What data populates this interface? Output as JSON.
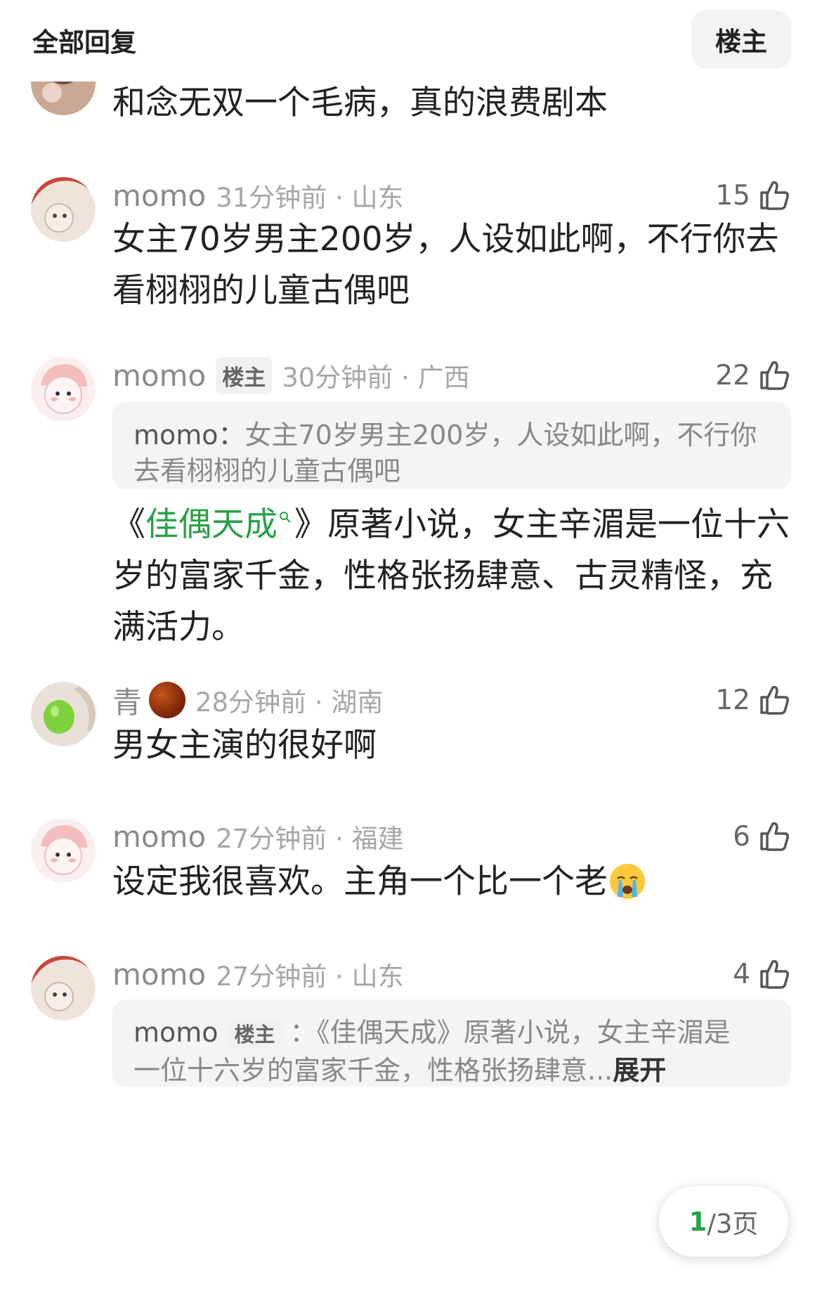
{
  "header": {
    "title": "全部回复",
    "filter_label": "楼主"
  },
  "comments": [
    {
      "text": "和念无双一个毛病，真的浪费剧本"
    },
    {
      "user": "momo",
      "time_loc": "31分钟前 · 山东",
      "likes": "15",
      "text": "女主70岁男主200岁，人设如此啊，不行你去看栩栩的儿童古偶吧"
    },
    {
      "user": "momo",
      "badge": "楼主",
      "time_loc": "30分钟前 · 广西",
      "likes": "22",
      "quote_user": "momo：",
      "quote_text": "女主70岁男主200岁，人设如此啊，不行你去看栩栩的儿童古偶吧",
      "link_open": "《",
      "link": "佳偶天成",
      "link_close": "》",
      "text": "原著小说，女主辛湄是一位十六岁的富家千金，性格张扬肆意、古灵精怪，充满活力。"
    },
    {
      "user": "青",
      "time_loc": "28分钟前 · 湖南",
      "likes": "12",
      "text": "男女主演的很好啊"
    },
    {
      "user": "momo",
      "time_loc": "27分钟前 · 福建",
      "likes": "6",
      "text": "设定我很喜欢。主角一个比一个老"
    },
    {
      "user": "momo",
      "time_loc": "27分钟前 · 山东",
      "likes": "4",
      "quote_user": "momo",
      "quote_badge": "楼主",
      "quote_sep": "：",
      "quote_line1": "《佳偶天成》原著小说，女主辛湄是",
      "quote_line2": "一位十六岁的富家千金，性格张扬肆意...",
      "expand": "展开"
    }
  ],
  "pager": {
    "current": "1",
    "rest": "/3页"
  },
  "icons": {
    "like": "thumbs-up-icon",
    "emoji": "crying-face-emoji",
    "link_search": "search-icon"
  },
  "colors": {
    "link": "#27a347",
    "meta": "#a6a6a6"
  }
}
